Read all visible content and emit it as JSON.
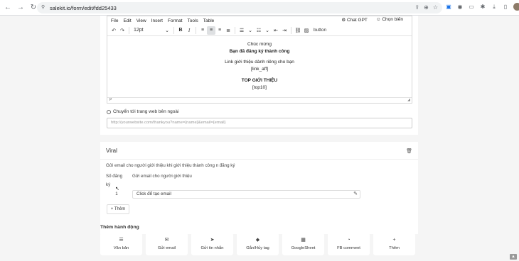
{
  "browser": {
    "url": "salekit.io/form/edit/fdd25433"
  },
  "editor": {
    "menu": [
      "File",
      "Edit",
      "View",
      "Insert",
      "Format",
      "Tools",
      "Table"
    ],
    "menu_right": [
      "Chat GPT",
      "Chọn biến"
    ],
    "font_size": "12pt",
    "toolbar_button_text": "button",
    "content": {
      "line1": "Chúc mừng",
      "line2": "Bạn đã đăng ký thành công",
      "line3": "Link giới thiệu dành riêng cho bạn",
      "line4": "[link_aff]",
      "line5": "TOP GIỚI THIỆU",
      "line6": "[top10]"
    },
    "status_path": "P"
  },
  "redirect": {
    "label": "Chuyển tới trang web bên ngoài",
    "placeholder": "http://yourwebsite.com/thankyou?name={name}&email={email}"
  },
  "viral": {
    "title": "Viral",
    "description": "Gửi email cho người giới thiệu khi giới thiệu thành công n đăng ký",
    "col_count_line1": "Số đăng",
    "col_count_line2": "ký",
    "col_email": "Gửi email cho người giới thiệu",
    "row_count": "1",
    "row_email": "Click để tạo email",
    "add_label": "+ Thêm"
  },
  "actions": {
    "title": "Thêm hành động",
    "items": [
      {
        "label": "Văn bản",
        "icon": "text-icon"
      },
      {
        "label": "Gửi email",
        "icon": "email-icon"
      },
      {
        "label": "Gửi tin nhắn",
        "icon": "send-icon"
      },
      {
        "label": "Gắn/Hủy tag",
        "icon": "tag-icon"
      },
      {
        "label": "GoogleSheet",
        "icon": "sheet-icon"
      },
      {
        "label": "FB comment",
        "icon": "comment-icon"
      },
      {
        "label": "Thêm",
        "icon": "plus-icon"
      }
    ]
  }
}
